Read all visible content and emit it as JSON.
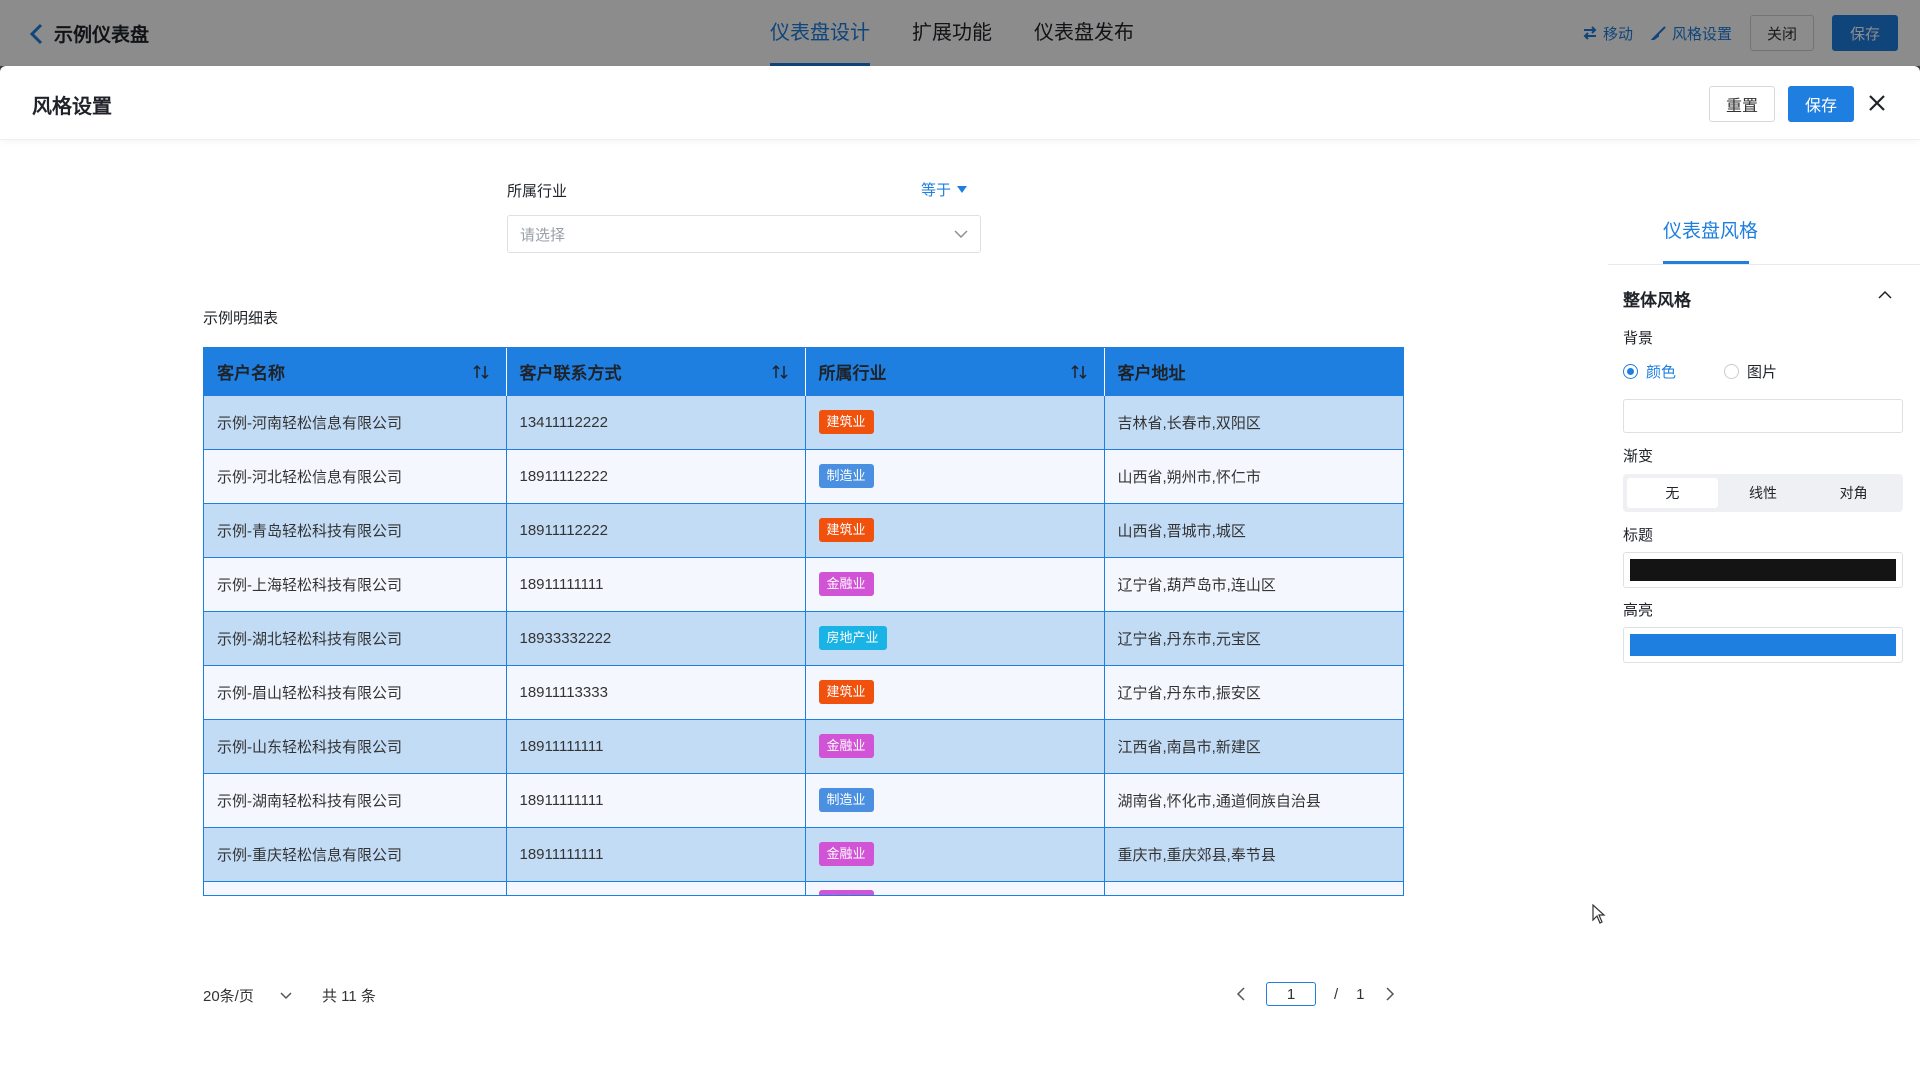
{
  "topbar": {
    "title": "示例仪表盘",
    "tabs": [
      "仪表盘设计",
      "扩展功能",
      "仪表盘发布"
    ],
    "move_label": "移动",
    "style_label": "风格设置",
    "close_label": "关闭",
    "save_label": "保存"
  },
  "drawer": {
    "title": "风格设置",
    "reset_label": "重置",
    "save_label": "保存"
  },
  "filter": {
    "label": "所属行业",
    "operator": "等于",
    "placeholder": "请选择"
  },
  "table": {
    "title": "示例明细表",
    "columns": [
      "客户名称",
      "客户联系方式",
      "所属行业",
      "客户地址"
    ],
    "rows": [
      {
        "name": "示例-河南轻松信息有限公司",
        "phone": "13411112222",
        "industry": "建筑业",
        "address": "吉林省,长春市,双阳区"
      },
      {
        "name": "示例-河北轻松信息有限公司",
        "phone": "18911112222",
        "industry": "制造业",
        "address": "山西省,朔州市,怀仁市"
      },
      {
        "name": "示例-青岛轻松科技有限公司",
        "phone": "18911112222",
        "industry": "建筑业",
        "address": "山西省,晋城市,城区"
      },
      {
        "name": "示例-上海轻松科技有限公司",
        "phone": "18911111111",
        "industry": "金融业",
        "address": "辽宁省,葫芦岛市,连山区"
      },
      {
        "name": "示例-湖北轻松科技有限公司",
        "phone": "18933332222",
        "industry": "房地产业",
        "address": "辽宁省,丹东市,元宝区"
      },
      {
        "name": "示例-眉山轻松科技有限公司",
        "phone": "18911113333",
        "industry": "建筑业",
        "address": "辽宁省,丹东市,振安区"
      },
      {
        "name": "示例-山东轻松科技有限公司",
        "phone": "18911111111",
        "industry": "金融业",
        "address": "江西省,南昌市,新建区"
      },
      {
        "name": "示例-湖南轻松科技有限公司",
        "phone": "18911111111",
        "industry": "制造业",
        "address": "湖南省,怀化市,通道侗族自治县"
      },
      {
        "name": "示例-重庆轻松信息有限公司",
        "phone": "18911111111",
        "industry": "金融业",
        "address": "重庆市,重庆郊县,奉节县"
      }
    ],
    "partial_row": {
      "industry": "金融业"
    },
    "industry_colors": {
      "建筑业": "#f0510d",
      "制造业": "#4a8fe0",
      "金融业": "#d153d6",
      "房地产业": "#19b3e6"
    }
  },
  "pagination": {
    "page_size": "20条/页",
    "total": "共 11 条",
    "current_page": "1",
    "separator": "/",
    "total_pages": "1"
  },
  "panel": {
    "tab": "仪表盘风格",
    "section_title": "整体风格",
    "background_label": "背景",
    "bg_options": [
      "颜色",
      "图片"
    ],
    "gradient_label": "渐变",
    "gradient_options": [
      "无",
      "线性",
      "对角"
    ],
    "title_label": "标题",
    "title_color": "#141414",
    "highlight_label": "高亮",
    "highlight_color": "#1e7fe0"
  },
  "colors": {
    "accent": "#1e7fe0",
    "row_odd": "#c3dcf6",
    "row_even": "#f4f8fe"
  }
}
